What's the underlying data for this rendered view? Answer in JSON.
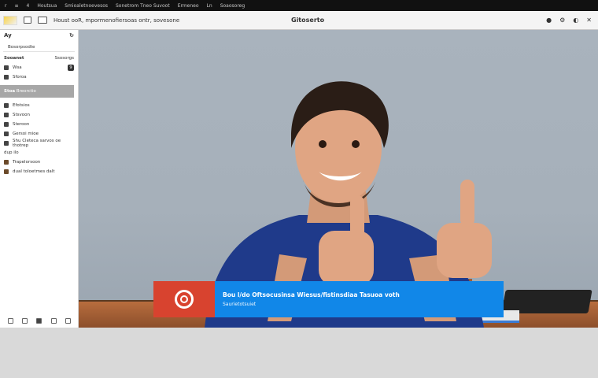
{
  "topbar": {
    "items": [
      "r",
      "≡",
      "4",
      "Houtsua",
      "Smioaletnoevesos",
      "Sonetrom Tneo Suvoot",
      "Ermeneo",
      "Ln",
      "Soaosoreg"
    ]
  },
  "titlebar": {
    "left_text": "Houst ooR, mpormenofiersoas ontr, sovesone",
    "center_title": "Gitoserto"
  },
  "sidebar": {
    "title": "Ay",
    "field_label": "Bosorpsodte",
    "header_row": {
      "left": "Sooanet",
      "right": "Ssosorgs"
    },
    "rows_top": [
      {
        "label": "Wsa",
        "badge": "9"
      },
      {
        "label": "Sforoa"
      }
    ],
    "section": {
      "tag": "Stoa",
      "label": "Breorctio"
    },
    "rows_mid": [
      {
        "label": "Efotsios"
      },
      {
        "label": "Stsvoon"
      },
      {
        "label": "Steroon"
      },
      {
        "label": "Gersoi mioe"
      },
      {
        "label": "Shu Cleteca sarvos oe thotrep"
      }
    ],
    "small_note": "dup ilo",
    "rows_bot": [
      {
        "label": "Trapelorsoon"
      },
      {
        "label": "dual toloetmes dalt"
      }
    ]
  },
  "lower_third": {
    "line1": "Bou l/do  Oftsocusinsa  Wiesus/fistinsdiaa  Tasuoa  voth",
    "line2": "Saurietotsuiet"
  },
  "colors": {
    "accent_blue": "#1187e8",
    "accent_red": "#d8432f",
    "sidebar_section": "#a7a7a7"
  }
}
